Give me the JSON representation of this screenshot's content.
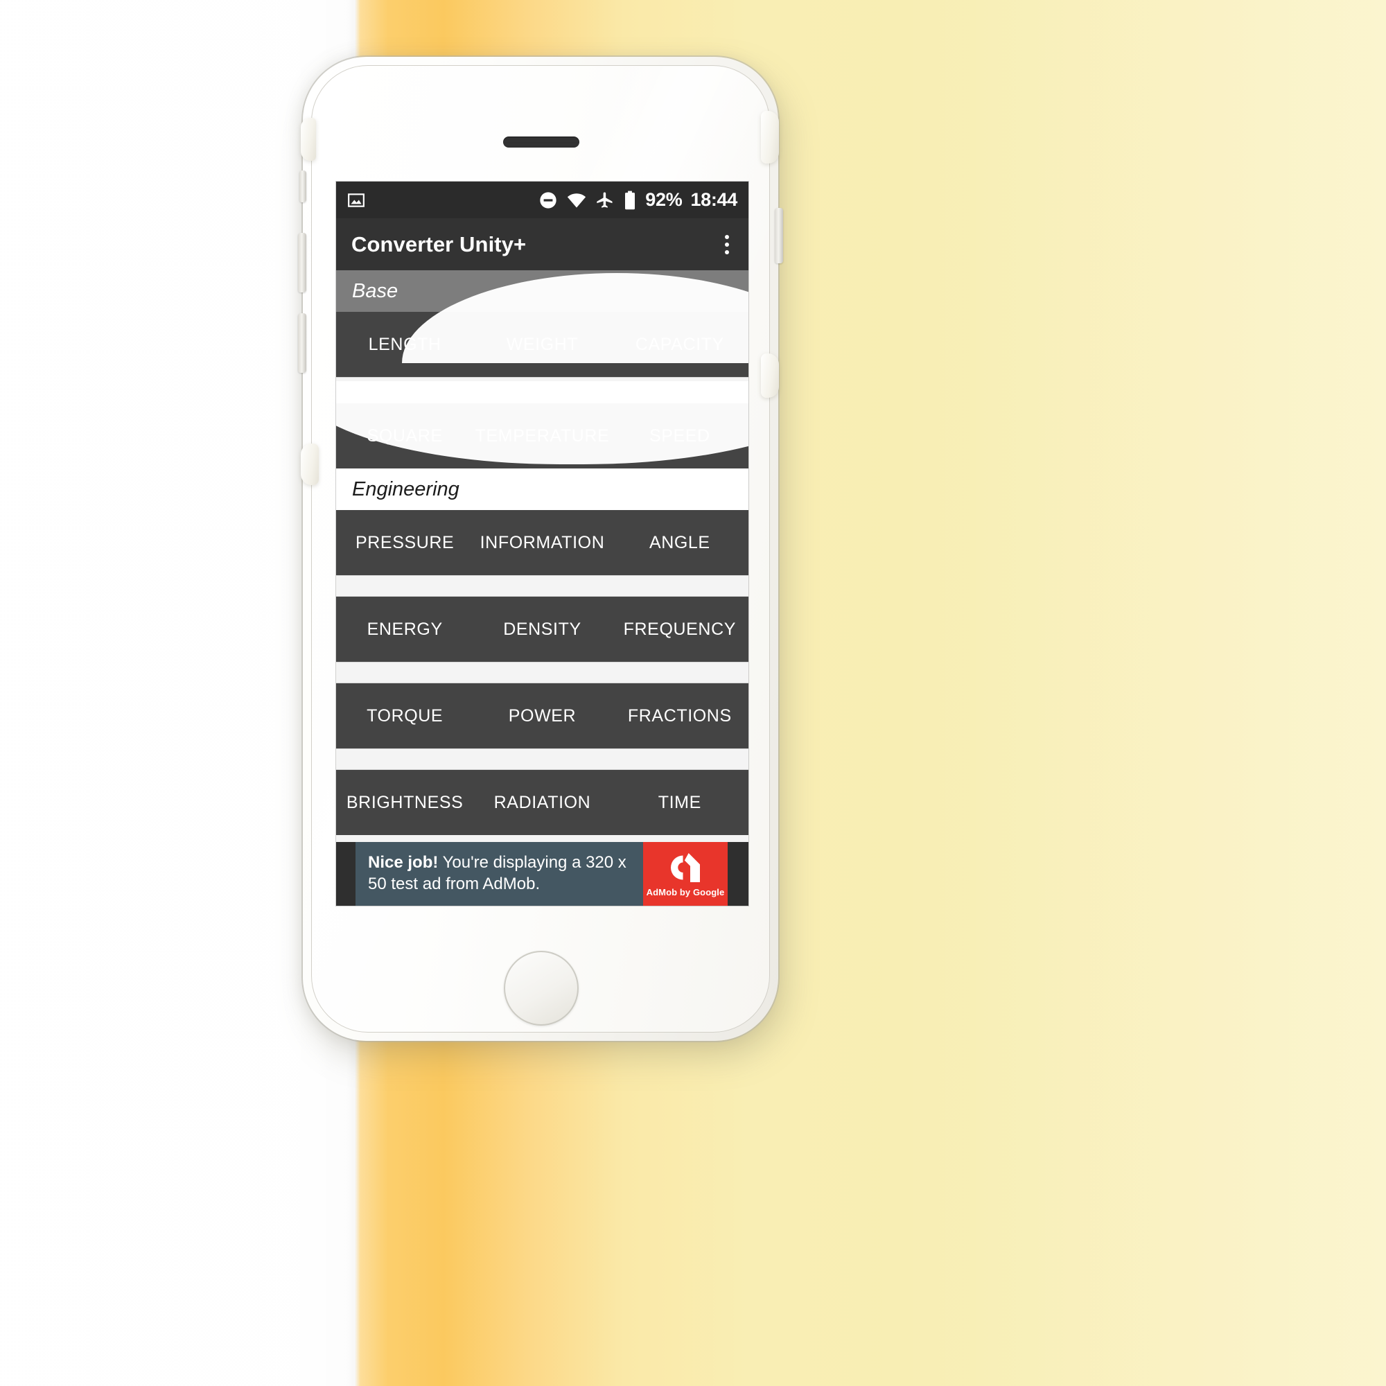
{
  "background": {
    "left_color": "#fbfbfb",
    "accent_color": "#fbc95f",
    "right_color": "#f9f0bb"
  },
  "device": {
    "name": "white-smartphone-with-case",
    "earpiece": "speaker-grille",
    "home_button": "home-button"
  },
  "statusbar": {
    "left_icons": [
      "image-icon"
    ],
    "right_icons": [
      "do-not-disturb-icon",
      "wifi-icon",
      "airplane-mode-icon",
      "battery-icon"
    ],
    "battery_percent": "92%",
    "time": "18:44",
    "background_color": "#2b2b2b"
  },
  "appbar": {
    "title": "Converter Unity+",
    "overflow_menu": "overflow-menu-icon",
    "background_color": "#333333"
  },
  "sections": [
    {
      "header": "Base",
      "header_style": "shaded",
      "rows": [
        [
          "LENGTH",
          "WEIGHT",
          "CAPACITY"
        ],
        [
          "SQUARE",
          "TEMPERATURE",
          "SPEED"
        ]
      ]
    },
    {
      "header": "Engineering",
      "header_style": "plain",
      "rows": [
        [
          "PRESSURE",
          "INFORMATION",
          "ANGLE"
        ],
        [
          "ENERGY",
          "DENSITY",
          "FREQUENCY"
        ],
        [
          "TORQUE",
          "POWER",
          "FRACTIONS"
        ],
        [
          "BRIGHTNESS",
          "RADIATION",
          "TIME"
        ]
      ]
    }
  ],
  "colors": {
    "button_row": "#444444",
    "section_shaded": "#7d7d7d",
    "divider": "#f4f4f4",
    "ad_body": "#445762",
    "ad_logo": "#e8352b"
  },
  "ad": {
    "headline": "Nice job!",
    "body": " You're displaying a 320 x 50 test ad from AdMob.",
    "logo_text": "AdMob by Google",
    "logo_mark": "admob-logo-icon"
  }
}
